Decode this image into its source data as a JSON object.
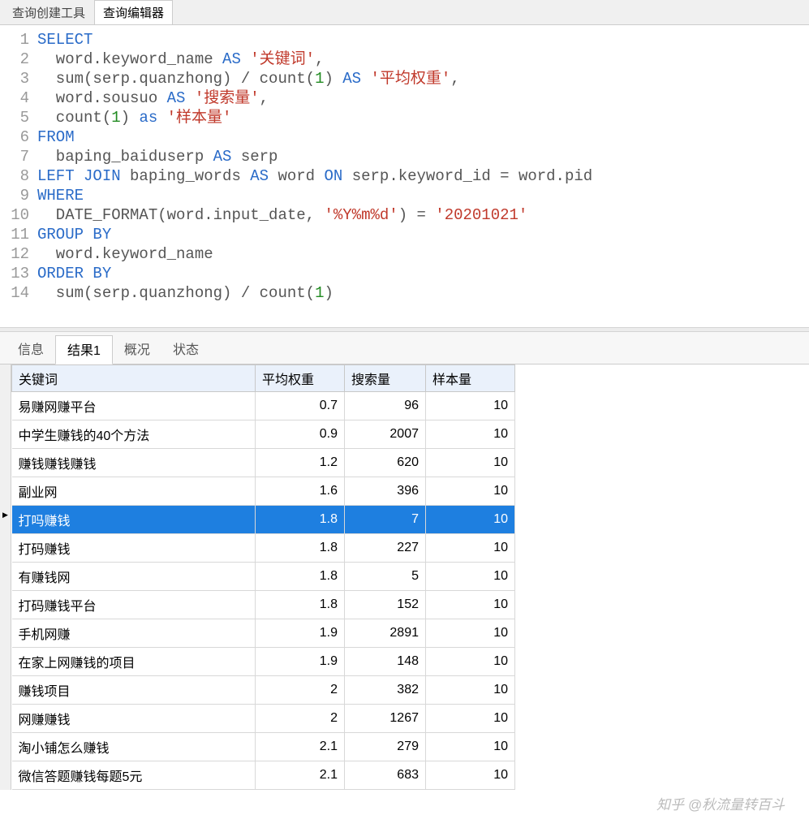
{
  "top_tabs": {
    "builder": "查询创建工具",
    "editor": "查询编辑器"
  },
  "sql": {
    "lines": [
      [
        {
          "t": "kw",
          "s": "SELECT"
        }
      ],
      [
        {
          "t": "txt",
          "s": "  word.keyword_name "
        },
        {
          "t": "kw",
          "s": "AS"
        },
        {
          "t": "txt",
          "s": " "
        },
        {
          "t": "str",
          "s": "'关键词'"
        },
        {
          "t": "txt",
          "s": ","
        }
      ],
      [
        {
          "t": "txt",
          "s": "  sum(serp.quanzhong) / count("
        },
        {
          "t": "num",
          "s": "1"
        },
        {
          "t": "txt",
          "s": ") "
        },
        {
          "t": "kw",
          "s": "AS"
        },
        {
          "t": "txt",
          "s": " "
        },
        {
          "t": "str",
          "s": "'平均权重'"
        },
        {
          "t": "txt",
          "s": ","
        }
      ],
      [
        {
          "t": "txt",
          "s": "  word.sousuo "
        },
        {
          "t": "kw",
          "s": "AS"
        },
        {
          "t": "txt",
          "s": " "
        },
        {
          "t": "str",
          "s": "'搜索量'"
        },
        {
          "t": "txt",
          "s": ","
        }
      ],
      [
        {
          "t": "txt",
          "s": "  count("
        },
        {
          "t": "num",
          "s": "1"
        },
        {
          "t": "txt",
          "s": ") "
        },
        {
          "t": "kw",
          "s": "as"
        },
        {
          "t": "txt",
          "s": " "
        },
        {
          "t": "str",
          "s": "'样本量'"
        }
      ],
      [
        {
          "t": "kw",
          "s": "FROM"
        }
      ],
      [
        {
          "t": "txt",
          "s": "  baping_baiduserp "
        },
        {
          "t": "kw",
          "s": "AS"
        },
        {
          "t": "txt",
          "s": " serp"
        }
      ],
      [
        {
          "t": "kw",
          "s": "LEFT JOIN"
        },
        {
          "t": "txt",
          "s": " baping_words "
        },
        {
          "t": "kw",
          "s": "AS"
        },
        {
          "t": "txt",
          "s": " word "
        },
        {
          "t": "kw",
          "s": "ON"
        },
        {
          "t": "txt",
          "s": " serp.keyword_id = word.pid"
        }
      ],
      [
        {
          "t": "kw",
          "s": "WHERE"
        }
      ],
      [
        {
          "t": "txt",
          "s": "  DATE_FORMAT(word.input_date, "
        },
        {
          "t": "str",
          "s": "'%Y%m%d'"
        },
        {
          "t": "txt",
          "s": ") = "
        },
        {
          "t": "str",
          "s": "'20201021'"
        }
      ],
      [
        {
          "t": "kw",
          "s": "GROUP BY"
        }
      ],
      [
        {
          "t": "txt",
          "s": "  word.keyword_name"
        }
      ],
      [
        {
          "t": "kw",
          "s": "ORDER BY"
        }
      ],
      [
        {
          "t": "txt",
          "s": "  sum(serp.quanzhong) / count("
        },
        {
          "t": "num",
          "s": "1"
        },
        {
          "t": "txt",
          "s": ")"
        }
      ]
    ]
  },
  "result_tabs": {
    "info": "信息",
    "result1": "结果1",
    "profile": "概况",
    "status": "状态"
  },
  "results": {
    "columns": [
      "关键词",
      "平均权重",
      "搜索量",
      "样本量"
    ],
    "selected_index": 4,
    "rows": [
      {
        "keyword": "易赚网赚平台",
        "weight": "0.7",
        "search": "96",
        "sample": "10"
      },
      {
        "keyword": "中学生赚钱的40个方法",
        "weight": "0.9",
        "search": "2007",
        "sample": "10"
      },
      {
        "keyword": "赚钱赚钱赚钱",
        "weight": "1.2",
        "search": "620",
        "sample": "10"
      },
      {
        "keyword": "副业网",
        "weight": "1.6",
        "search": "396",
        "sample": "10"
      },
      {
        "keyword": "打吗赚钱",
        "weight": "1.8",
        "search": "7",
        "sample": "10"
      },
      {
        "keyword": "打码赚钱",
        "weight": "1.8",
        "search": "227",
        "sample": "10"
      },
      {
        "keyword": "有赚钱网",
        "weight": "1.8",
        "search": "5",
        "sample": "10"
      },
      {
        "keyword": "打码赚钱平台",
        "weight": "1.8",
        "search": "152",
        "sample": "10"
      },
      {
        "keyword": "手机网赚",
        "weight": "1.9",
        "search": "2891",
        "sample": "10"
      },
      {
        "keyword": "在家上网赚钱的项目",
        "weight": "1.9",
        "search": "148",
        "sample": "10"
      },
      {
        "keyword": "赚钱项目",
        "weight": "2",
        "search": "382",
        "sample": "10"
      },
      {
        "keyword": "网赚赚钱",
        "weight": "2",
        "search": "1267",
        "sample": "10"
      },
      {
        "keyword": "淘小铺怎么赚钱",
        "weight": "2.1",
        "search": "279",
        "sample": "10"
      },
      {
        "keyword": "微信答题赚钱每题5元",
        "weight": "2.1",
        "search": "683",
        "sample": "10"
      }
    ]
  },
  "watermark": "知乎 @秋流量转百斗"
}
